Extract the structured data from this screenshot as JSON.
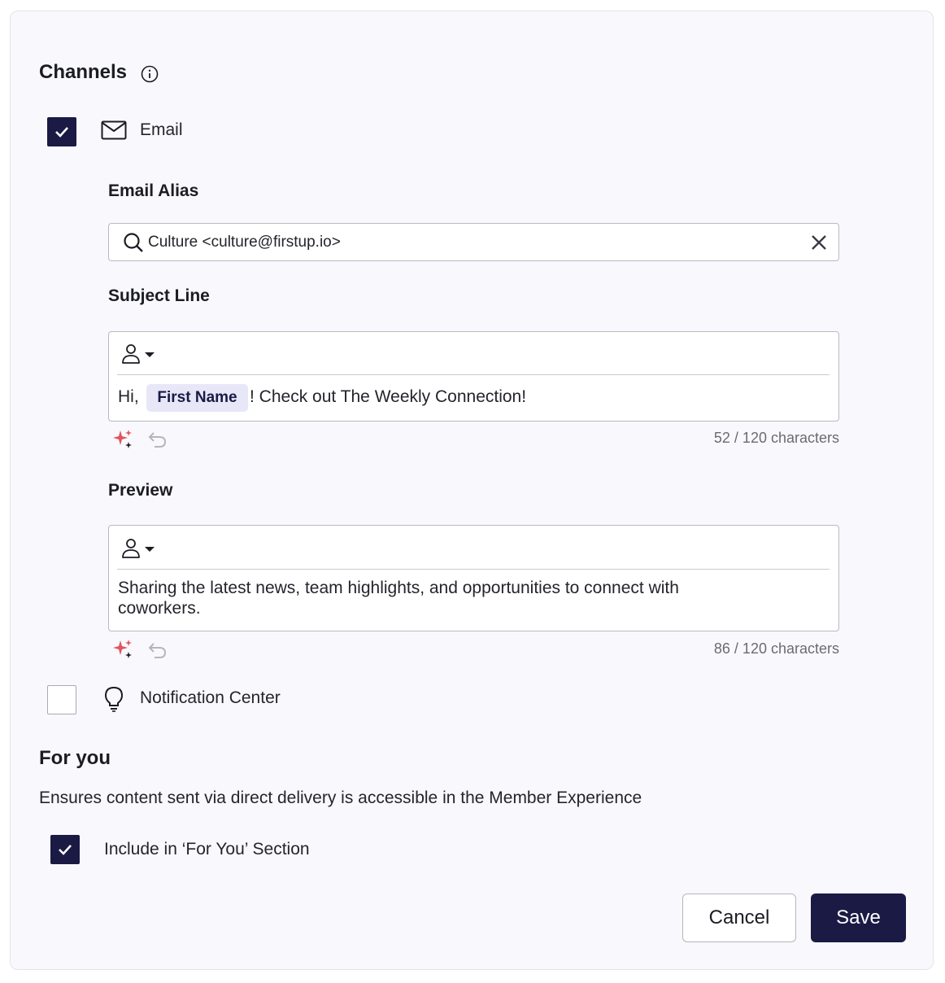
{
  "channels": {
    "title": "Channels",
    "email": {
      "label": "Email",
      "checked": true,
      "alias": {
        "label": "Email Alias",
        "value": "Culture <culture@firstup.io>"
      },
      "subject": {
        "label": "Subject Line",
        "prefix": "Hi,",
        "token": "First Name",
        "suffix": "! Check out The Weekly Connection!",
        "counter": "52 / 120 characters"
      },
      "preview": {
        "label": "Preview",
        "line1": "Sharing the latest news, team highlights, and opportunities to connect with",
        "line2": "coworkers.",
        "counter": "86 / 120 characters"
      }
    },
    "notification_center": {
      "label": "Notification Center",
      "checked": false
    }
  },
  "for_you": {
    "title": "For you",
    "description": "Ensures content sent via direct delivery is accessible in the Member Experience",
    "include_label": "Include in ‘For You’ Section",
    "checked": true
  },
  "actions": {
    "cancel": "Cancel",
    "save": "Save"
  },
  "colors": {
    "accent": "#1a1a44",
    "ai_sparkle": "#e0555f",
    "token_bg": "#e8e7f8"
  },
  "icons": [
    "info-icon",
    "mail-icon",
    "search-icon",
    "close-icon",
    "personalize-icon",
    "sparkle-icon",
    "undo-icon",
    "lightbulb-icon",
    "check-icon"
  ]
}
